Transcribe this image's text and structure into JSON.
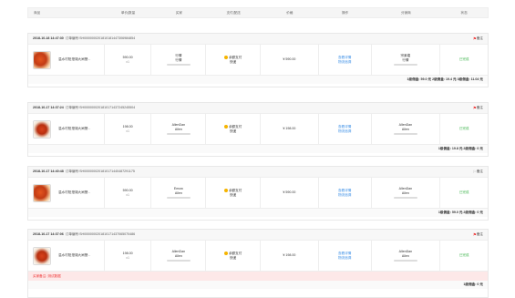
{
  "columns": [
    "商品",
    "单价|数量",
    "买家",
    "支付|配送",
    "价格",
    "操作",
    "分销商",
    "状态"
  ],
  "orders": [
    {
      "time": "2018-10-18 14:47:30",
      "order_label": "订单编号:",
      "order_no": "SH0000000201810181447306984854",
      "remark": "备注",
      "flag_color": "#e33333",
      "product_name": "温水村阳澄湖大闸蟹...",
      "price": "590.00",
      "qty": "x1",
      "buyer_line1": "行情",
      "buyer_line2": "行情",
      "pay": "余额支付",
      "ship": "快递",
      "amount": "¥ 590.00",
      "op1": "查看详情",
      "op2": "物流追溯",
      "dist_line1": "宗紫煌",
      "dist_line2": "行情",
      "status": "已完成",
      "commission": "1级佣金: 59.0 元 2级佣金: 19.4 元 3级佣金: 11.04 元"
    },
    {
      "time": "2018-10-17 14:37:24",
      "order_label": "订单编号:",
      "order_no": "SH0000000201810171437245245504",
      "remark": "备注",
      "flag_color": "#e33333",
      "product_name": "温水村阳澄湖大闸蟹...",
      "price": "198.00",
      "qty": "x1",
      "buyer_line1": "AllenDan",
      "buyer_line2": "Allen",
      "pay": "余额支付",
      "ship": "快递",
      "amount": "¥ 198.00",
      "op1": "查看详情",
      "op2": "物流追溯",
      "dist_line1": "AllenDan",
      "dist_line2": "Allen",
      "status": "已完成",
      "commission": "1级佣金: 19.8 元 2级佣金: 0 元"
    },
    {
      "time": "2018-10-17 14:40:48",
      "order_label": "订单编号:",
      "order_no": "SH0000000201810171440487291175",
      "remark": "备注",
      "flag_color": "#aaaaaa",
      "product_name": "温水村阳澄湖大闸蟹...",
      "price": "590.00",
      "qty": "x1",
      "buyer_line1": "Emow",
      "buyer_line2": "Allen",
      "pay": "余额支付",
      "ship": "快递",
      "amount": "¥ 590.00",
      "op1": "查看详情",
      "op2": "物流追溯",
      "dist_line1": "AllenDan",
      "dist_line2": "Allen",
      "status": "已完成",
      "commission": "1级佣金: 59.0 元 2级佣金: 0 元"
    },
    {
      "time": "2018-10-17 14:37:06",
      "order_label": "订单编号:",
      "order_no": "SH0000000201810171437065070486",
      "remark": "备注",
      "flag_color": "#e33333",
      "product_name": "温水村阳澄湖大闸蟹...",
      "price": "198.00",
      "qty": "x1",
      "buyer_line1": "AllenDan",
      "buyer_line2": "Allen",
      "pay": "余额支付",
      "ship": "快递",
      "amount": "¥ 198.00",
      "op1": "查看详情",
      "op2": "物流追溯",
      "dist_line1": "AllenDan",
      "dist_line2": "Allen",
      "status": "已完成",
      "note": "买家备注: 测试数据",
      "commission": "1级佣金: 0 元"
    }
  ]
}
